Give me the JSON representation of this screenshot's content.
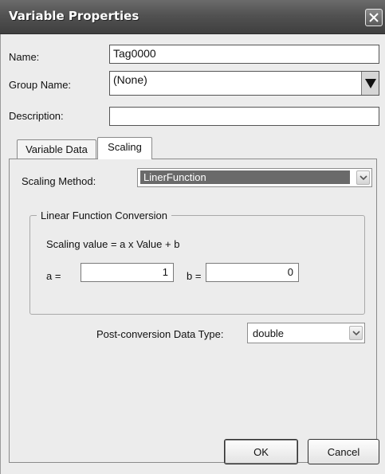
{
  "window": {
    "title": "Variable Properties"
  },
  "form": {
    "name_label": "Name:",
    "name_value": "Tag0000",
    "group_label": "Group Name:",
    "group_value": "(None)",
    "description_label": "Description:",
    "description_value": ""
  },
  "tabs": [
    {
      "label": "Variable Data",
      "active": false
    },
    {
      "label": "Scaling",
      "active": true
    }
  ],
  "scaling": {
    "method_label": "Scaling Method:",
    "method_value": "LinerFunction",
    "group_title": "Linear Function Conversion",
    "formula": "Scaling value = a x Value + b",
    "a_label": "a =",
    "a_value": "1",
    "b_label": "b =",
    "b_value": "0",
    "post_label": "Post-conversion Data Type:",
    "post_value": "double"
  },
  "buttons": {
    "ok": "OK",
    "cancel": "Cancel"
  },
  "icons": {
    "close": "close-icon",
    "dropdown": "triangle-down-icon",
    "select_arrow": "chevron-down-icon"
  }
}
